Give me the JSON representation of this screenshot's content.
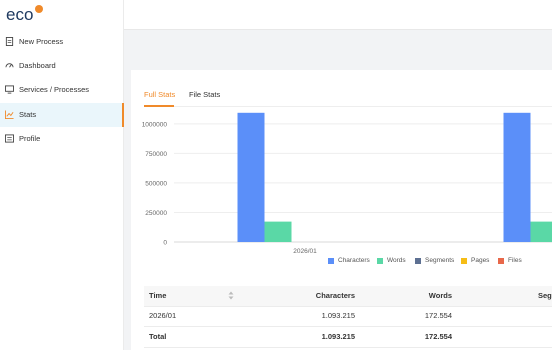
{
  "app": {
    "logo_text": "eco"
  },
  "sidebar": {
    "items": [
      {
        "label": "New Process",
        "icon": "document-icon",
        "active": false
      },
      {
        "label": "Dashboard",
        "icon": "dashboard-icon",
        "active": false
      },
      {
        "label": "Services / Processes",
        "icon": "monitor-icon",
        "active": false
      },
      {
        "label": "Stats",
        "icon": "stats-icon",
        "active": true
      },
      {
        "label": "Profile",
        "icon": "profile-icon",
        "active": false
      }
    ]
  },
  "tabs": [
    {
      "label": "Full Stats",
      "active": true
    },
    {
      "label": "File Stats",
      "active": false
    }
  ],
  "colors": {
    "accent": "#f08a2a",
    "characters": "#5b8ff9",
    "words": "#5ad8a6",
    "segments": "#5d7092",
    "pages": "#f6bd16",
    "files": "#e8684a"
  },
  "chart_data": {
    "type": "bar",
    "categories": [
      "2026/01"
    ],
    "series": [
      {
        "name": "Characters",
        "values": [
          1093215
        ]
      },
      {
        "name": "Words",
        "values": [
          172554
        ]
      },
      {
        "name": "Segments",
        "values": [
          0
        ]
      },
      {
        "name": "Pages",
        "values": [
          0
        ]
      },
      {
        "name": "Files",
        "values": [
          0
        ]
      }
    ],
    "y_ticks": [
      "0",
      "250000",
      "500000",
      "750000",
      "1000000"
    ],
    "ylim": [
      0,
      1100000
    ],
    "legend_position": "bottom",
    "grid": true
  },
  "table": {
    "headers": [
      "Time",
      "Characters",
      "Words",
      "Segme"
    ],
    "rows": [
      [
        "2026/01",
        "1.093.215",
        "172.554",
        ""
      ],
      [
        "Total",
        "1.093.215",
        "172.554",
        ""
      ]
    ]
  }
}
